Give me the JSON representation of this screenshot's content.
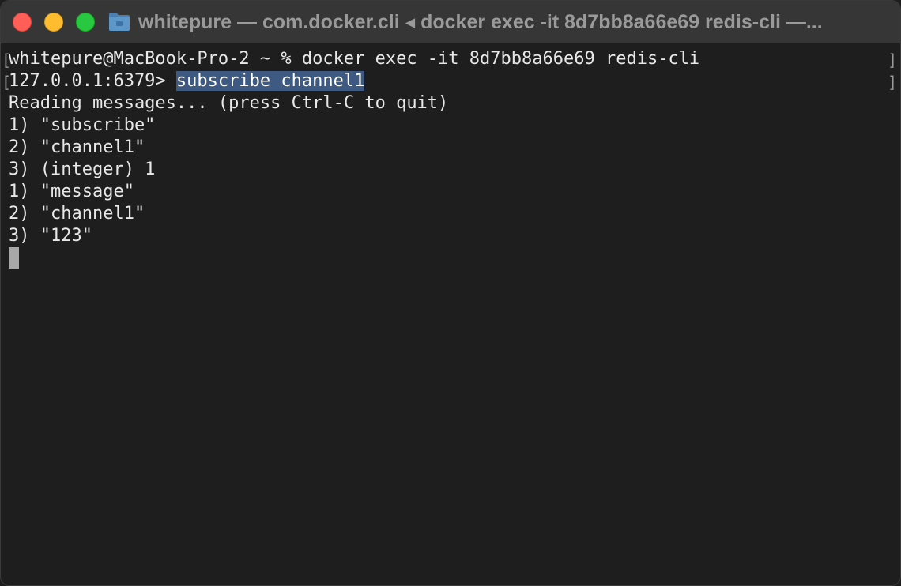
{
  "window": {
    "title": "whitepure — com.docker.cli ◂ docker exec -it 8d7bb8a66e69 redis-cli —..."
  },
  "icons": {
    "close": "close-icon",
    "minimize": "minimize-icon",
    "maximize": "maximize-icon",
    "folder": "folder-icon"
  },
  "colors": {
    "close": "#ff5f57",
    "minimize": "#febc2e",
    "maximize": "#28c840",
    "selection": "#3e5a82",
    "background": "#1e1e1e"
  },
  "terminal": {
    "lines": [
      "whitepure@MacBook-Pro-2 ~ % docker exec -it 8d7bb8a66e69 redis-cli",
      "127.0.0.1:6379> ",
      "Reading messages... (press Ctrl-C to quit)",
      "1) \"subscribe\"",
      "2) \"channel1\"",
      "3) (integer) 1",
      "1) \"message\"",
      "2) \"channel1\"",
      "3) \"123\""
    ],
    "selected_command": "subscribe channel1",
    "bracket_left": "[",
    "bracket_right": "]"
  }
}
